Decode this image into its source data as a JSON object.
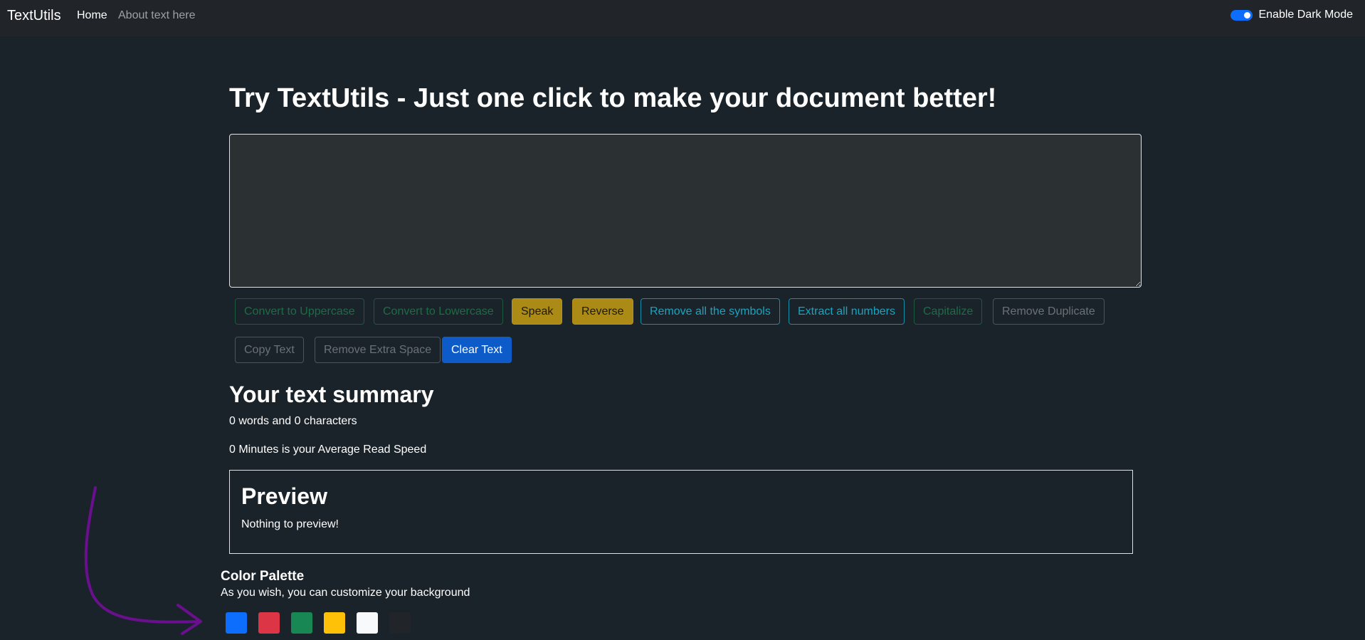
{
  "navbar": {
    "brand": "TextUtils",
    "links": [
      "Home",
      "About text here"
    ],
    "dark_mode_label": "Enable Dark Mode",
    "dark_mode_enabled": true
  },
  "main": {
    "title": "Try TextUtils - Just one click to make your document better!",
    "textarea_value": "",
    "buttons": [
      {
        "label": "Convert to Uppercase",
        "style": "outline-success",
        "disabled": true
      },
      {
        "label": "Convert to Lowercase",
        "style": "outline-success",
        "disabled": true
      },
      {
        "label": "Speak",
        "style": "warning"
      },
      {
        "label": "Reverse",
        "style": "warning"
      },
      {
        "label": "Remove all the symbols",
        "style": "outline-info"
      },
      {
        "label": "Extract all numbers",
        "style": "outline-info"
      },
      {
        "label": "Capitalize",
        "style": "outline-success",
        "disabled": true
      },
      {
        "label": "Remove Duplicate",
        "style": "outline-secondary",
        "disabled": true
      },
      {
        "label": "Copy Text",
        "style": "outline-secondary",
        "disabled": true
      },
      {
        "label": "Remove Extra Space",
        "style": "outline-secondary",
        "disabled": true
      },
      {
        "label": "Clear Text",
        "style": "primary"
      }
    ]
  },
  "summary": {
    "heading": "Your text summary",
    "counts": "0 words and 0 characters",
    "read_speed": "0 Minutes is your Average Read Speed"
  },
  "preview": {
    "heading": "Preview",
    "text": "Nothing to preview!"
  },
  "palette": {
    "heading": "Color Palette",
    "subtitle": "As you wish, you can customize your background",
    "colors": [
      "#0d6efd",
      "#dc3545",
      "#198754",
      "#ffc107",
      "#f8f9fa",
      "#212529"
    ]
  },
  "colors": {
    "background": "#1a232a",
    "navbar": "#212529",
    "accent": "#0d6efd",
    "arrow": "#6a0f8e"
  }
}
